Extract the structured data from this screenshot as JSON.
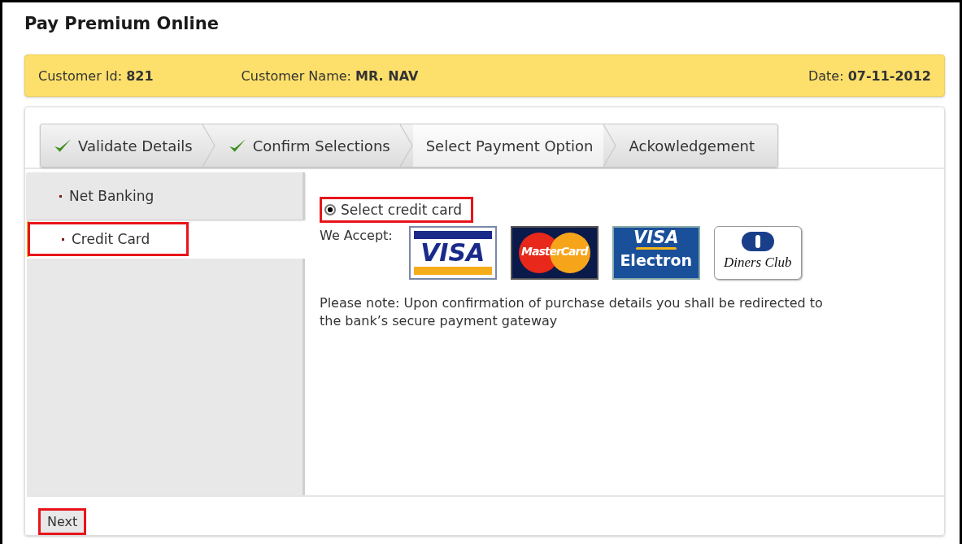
{
  "title": "Pay Premium Online",
  "customer_bar": {
    "id_label": "Customer Id:",
    "id_value": "821",
    "name_label": "Customer Name:",
    "name_value": "MR. NAV",
    "date_label": "Date:",
    "date_value": "07-11-2012"
  },
  "steps": [
    {
      "label": "Validate Details",
      "done": true,
      "selected": false
    },
    {
      "label": "Confirm Selections",
      "done": true,
      "selected": false
    },
    {
      "label": "Select Payment Option",
      "done": false,
      "selected": true
    },
    {
      "label": "Ackowledgement",
      "done": false,
      "selected": false
    }
  ],
  "sidebar": {
    "items": [
      {
        "label": "Net Banking",
        "selected": false,
        "highlighted": false
      },
      {
        "label": "Credit Card",
        "selected": true,
        "highlighted": true
      }
    ]
  },
  "payment": {
    "radio": {
      "label": "Select credit card",
      "checked": true,
      "highlighted": true
    },
    "accept_label": "We Accept:",
    "cards": [
      {
        "kind": "visa",
        "lines": [
          "VISA"
        ]
      },
      {
        "kind": "mastercard",
        "lines": [
          "MasterCard"
        ]
      },
      {
        "kind": "visa_electron",
        "lines": [
          "VISA",
          "Electron"
        ]
      },
      {
        "kind": "diners",
        "lines": [
          "Diners Club"
        ]
      }
    ],
    "note": "Please note: Upon confirmation of purchase details you shall be redirected to the bank’s secure payment gateway"
  },
  "next_button": {
    "label": "Next",
    "highlighted": true
  }
}
